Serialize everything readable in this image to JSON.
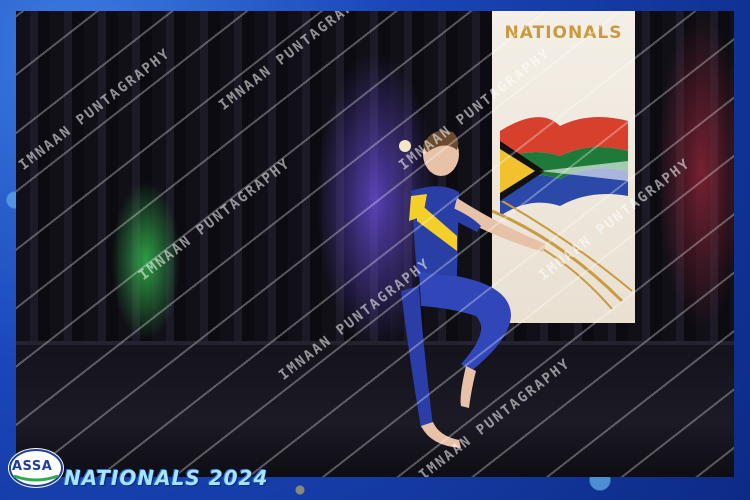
{
  "photo": {
    "banner_title": "NATIONALS",
    "watermark_text": "IMNAAN PUNTAGRAPHY"
  },
  "footer": {
    "logo_text": "ASSA",
    "title": "NATIONALS 2024"
  },
  "colors": {
    "frame_blue": "#1a46b8",
    "footer_text": "#a9e4ff",
    "banner_gold": "#c99a3e"
  }
}
